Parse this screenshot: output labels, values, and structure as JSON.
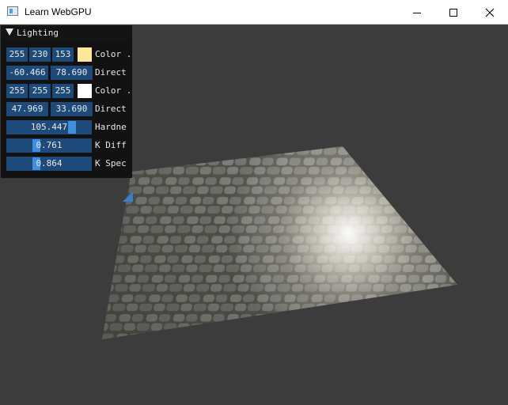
{
  "window": {
    "title": "Learn WebGPU",
    "icon": "app-window-icon",
    "controls": [
      "minimize-icon",
      "maximize-icon",
      "close-icon"
    ]
  },
  "colors": {
    "background": "#3c3c3c",
    "field": "#1e4a7a",
    "slider_grab": "#3f8fe0",
    "swatch_1": "#ffe699",
    "swatch_2": "#ffffff"
  },
  "panel": {
    "title": "Lighting",
    "collapse_icon": "triangle-down-icon",
    "rows": [
      {
        "type": "color",
        "values": [
          "255",
          "230",
          "153"
        ],
        "label": "Color ."
      },
      {
        "type": "vec2",
        "values": [
          "-60.466",
          "78.690"
        ],
        "label": "Direct"
      },
      {
        "type": "color",
        "values": [
          "255",
          "255",
          "255"
        ],
        "label": "Color ."
      },
      {
        "type": "vec2",
        "values": [
          "47.969",
          "33.690"
        ],
        "label": "Direct"
      },
      {
        "type": "slider",
        "value": "105.447",
        "fraction": 0.8,
        "label": "Hardne"
      },
      {
        "type": "slider",
        "value": "0.761",
        "fraction": 0.34,
        "label": "K Diff"
      },
      {
        "type": "slider",
        "value": "0.864",
        "fraction": 0.34,
        "label": "K Spec"
      }
    ]
  }
}
